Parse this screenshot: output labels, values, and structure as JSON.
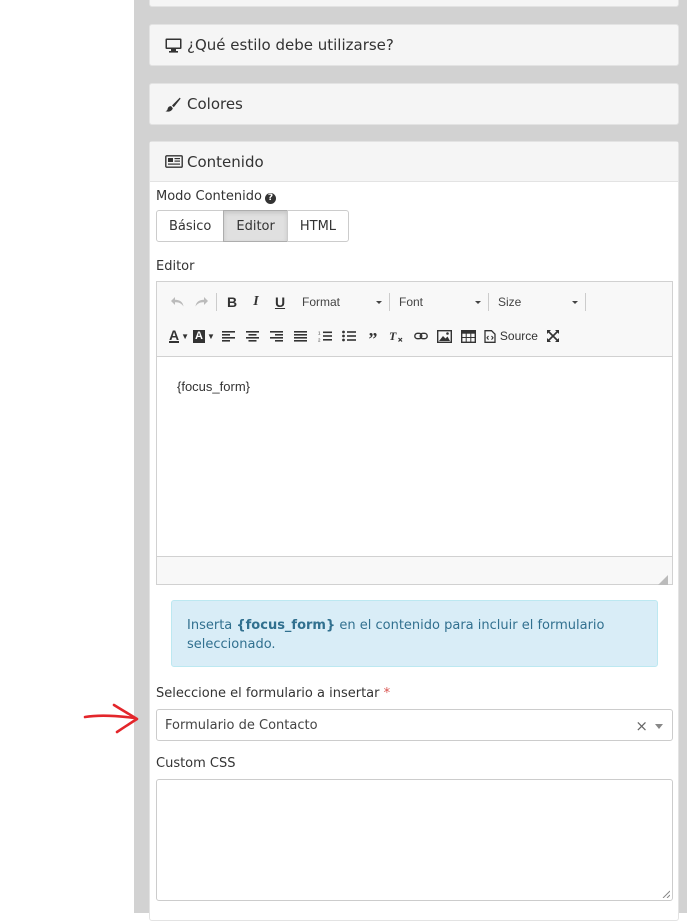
{
  "sections": {
    "style": {
      "title": "¿Qué estilo debe utilizarse?",
      "icon": "monitor-icon"
    },
    "colors": {
      "title": "Colores",
      "icon": "paintbrush-icon"
    },
    "content": {
      "title": "Contenido",
      "icon": "newspaper-icon"
    }
  },
  "content_mode": {
    "label": "Modo Contenido",
    "help_icon": "question-circle-icon",
    "options": [
      "Básico",
      "Editor",
      "HTML"
    ],
    "selected": "Editor"
  },
  "editor": {
    "label": "Editor",
    "toolbar": {
      "undo": "undo-icon",
      "redo": "redo-icon",
      "bold": "B",
      "italic": "I",
      "underline": "U",
      "format_label": "Format",
      "font_label": "Font",
      "size_label": "Size",
      "text_color": "A",
      "bg_color": "A",
      "source_label": "Source"
    },
    "body_text": "{focus_form}"
  },
  "info_alert": {
    "prefix": "Inserta ",
    "token": "{focus_form}",
    "suffix": " en el contenido para incluir el formulario seleccionado."
  },
  "form_select": {
    "label": "Seleccione el formulario a insertar",
    "required_mark": "*",
    "value": "Formulario de Contacto",
    "clear_symbol": "×"
  },
  "custom_css": {
    "label": "Custom CSS",
    "value": ""
  },
  "colors": {
    "annotation_arrow": "#e3262b",
    "alert_bg": "#d9edf7",
    "alert_text": "#31708f",
    "required": "#d9534f"
  }
}
